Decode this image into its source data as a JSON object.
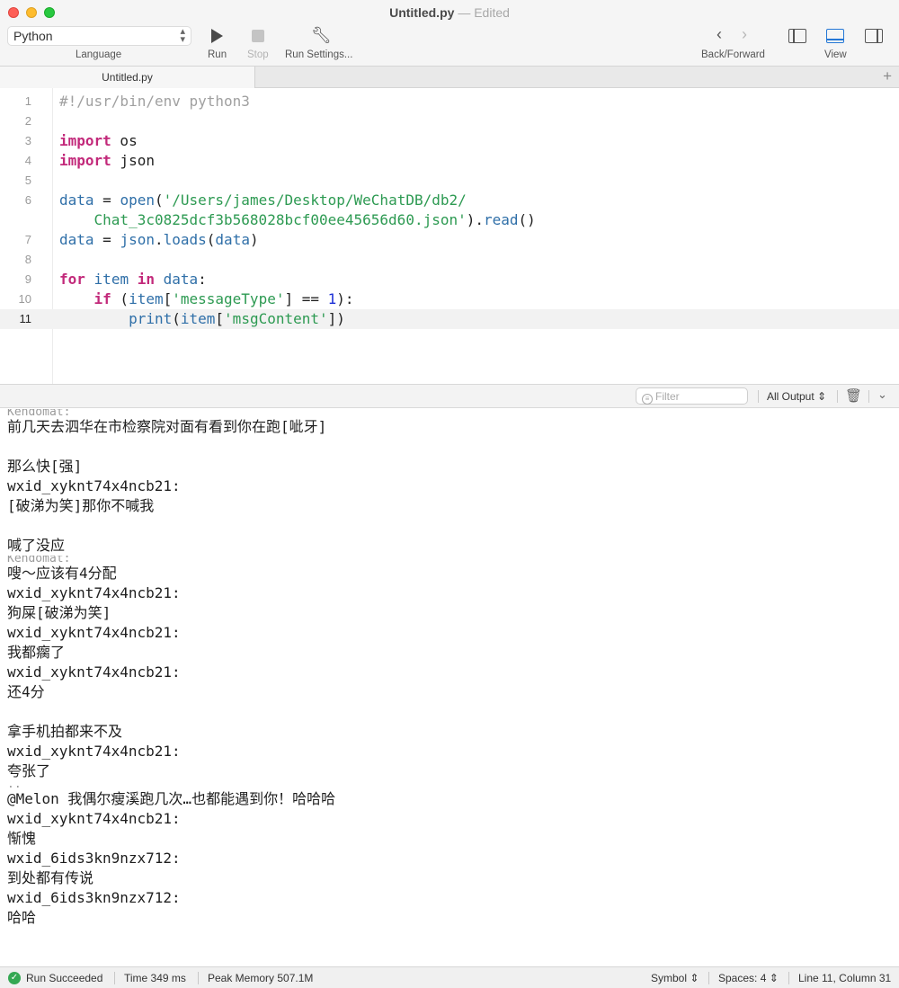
{
  "window": {
    "title": "Untitled.py",
    "separator": "—",
    "status": "Edited"
  },
  "toolbar": {
    "language_value": "Python",
    "language_label": "Language",
    "run_label": "Run",
    "stop_label": "Stop",
    "run_settings_label": "Run Settings...",
    "back_forward_label": "Back/Forward",
    "view_label": "View"
  },
  "tabs": [
    {
      "label": "Untitled.py",
      "active": true
    }
  ],
  "editor": {
    "current_line": 11,
    "lines": [
      {
        "num": "1",
        "tokens": [
          {
            "t": "#!/usr/bin/env python3",
            "c": "cm"
          }
        ]
      },
      {
        "num": "2",
        "tokens": []
      },
      {
        "num": "3",
        "tokens": [
          {
            "t": "import",
            "c": "kw"
          },
          {
            "t": " os",
            "c": "pl"
          }
        ]
      },
      {
        "num": "4",
        "tokens": [
          {
            "t": "import",
            "c": "kw"
          },
          {
            "t": " json",
            "c": "pl"
          }
        ]
      },
      {
        "num": "5",
        "tokens": []
      },
      {
        "num": "6",
        "tokens": [
          {
            "t": "data",
            "c": "fn"
          },
          {
            "t": " = ",
            "c": "pl"
          },
          {
            "t": "open",
            "c": "fn"
          },
          {
            "t": "(",
            "c": "pl"
          },
          {
            "t": "'/Users/james/Desktop/WeChatDB/db2/",
            "c": "str"
          }
        ]
      },
      {
        "num": "",
        "tokens": [
          {
            "t": "    Chat_3c0825dcf3b568028bcf00ee45656d60.json'",
            "c": "str"
          },
          {
            "t": ").",
            "c": "pl"
          },
          {
            "t": "read",
            "c": "fn"
          },
          {
            "t": "()",
            "c": "pl"
          }
        ]
      },
      {
        "num": "7",
        "tokens": [
          {
            "t": "data",
            "c": "fn"
          },
          {
            "t": " = ",
            "c": "pl"
          },
          {
            "t": "json",
            "c": "fn"
          },
          {
            "t": ".",
            "c": "pl"
          },
          {
            "t": "loads",
            "c": "fn"
          },
          {
            "t": "(",
            "c": "pl"
          },
          {
            "t": "data",
            "c": "fn"
          },
          {
            "t": ")",
            "c": "pl"
          }
        ]
      },
      {
        "num": "8",
        "tokens": []
      },
      {
        "num": "9",
        "tokens": [
          {
            "t": "for",
            "c": "kw"
          },
          {
            "t": " ",
            "c": "pl"
          },
          {
            "t": "item",
            "c": "fn"
          },
          {
            "t": " ",
            "c": "pl"
          },
          {
            "t": "in",
            "c": "kw"
          },
          {
            "t": " ",
            "c": "pl"
          },
          {
            "t": "data",
            "c": "fn"
          },
          {
            "t": ":",
            "c": "pl"
          }
        ]
      },
      {
        "num": "10",
        "tokens": [
          {
            "t": "    ",
            "c": "pl"
          },
          {
            "t": "if",
            "c": "kw"
          },
          {
            "t": " (",
            "c": "pl"
          },
          {
            "t": "item",
            "c": "fn"
          },
          {
            "t": "[",
            "c": "pl"
          },
          {
            "t": "'messageType'",
            "c": "str"
          },
          {
            "t": "] == ",
            "c": "pl"
          },
          {
            "t": "1",
            "c": "num"
          },
          {
            "t": "):",
            "c": "pl"
          }
        ]
      },
      {
        "num": "11",
        "tokens": [
          {
            "t": "        ",
            "c": "pl"
          },
          {
            "t": "print",
            "c": "fn"
          },
          {
            "t": "(",
            "c": "pl"
          },
          {
            "t": "item",
            "c": "fn"
          },
          {
            "t": "[",
            "c": "pl"
          },
          {
            "t": "'msgContent'",
            "c": "str"
          },
          {
            "t": "])",
            "c": "pl"
          }
        ]
      }
    ]
  },
  "output_header": {
    "filter_placeholder": "Filter",
    "output_select": "All Output"
  },
  "console_lines": [
    {
      "text": "Kendomat:",
      "partial": true
    },
    {
      "text": "前几天去泗华在市检察院对面有看到你在跑[呲牙]"
    },
    {
      "text": ""
    },
    {
      "text": "那么快[强]"
    },
    {
      "text": "wxid_xyknt74x4ncb21:"
    },
    {
      "text": "[破涕为笑]那你不喊我"
    },
    {
      "text": ""
    },
    {
      "text": "喊了没应"
    },
    {
      "text": "Kendomat:",
      "partial": true
    },
    {
      "text": "嗖～应该有4分配"
    },
    {
      "text": "wxid_xyknt74x4ncb21:"
    },
    {
      "text": "狗屎[破涕为笑]"
    },
    {
      "text": "wxid_xyknt74x4ncb21:"
    },
    {
      "text": "我都瘸了"
    },
    {
      "text": "wxid_xyknt74x4ncb21:"
    },
    {
      "text": "还4分"
    },
    {
      "text": ""
    },
    {
      "text": "拿手机拍都来不及"
    },
    {
      "text": "wxid_xyknt74x4ncb21:"
    },
    {
      "text": "夸张了"
    },
    {
      "text": "..",
      "partial": true
    },
    {
      "text": "@Melon 我偶尔瘦溪跑几次…也都能遇到你！哈哈哈"
    },
    {
      "text": "wxid_xyknt74x4ncb21:"
    },
    {
      "text": "惭愧"
    },
    {
      "text": "wxid_6ids3kn9nzx712:"
    },
    {
      "text": "到处都有传说"
    },
    {
      "text": "wxid_6ids3kn9nzx712:"
    },
    {
      "text": "哈哈"
    }
  ],
  "status_bar": {
    "run_status": "Run Succeeded",
    "time": "Time 349 ms",
    "peak_memory": "Peak Memory 507.1M",
    "syntax": "Symbol",
    "indent": "Spaces: 4",
    "cursor": "Line 11, Column 31"
  },
  "colors": {
    "keyword": "#c2297a",
    "identifier": "#2f6fa8",
    "string": "#2d9a52",
    "number": "#1c2fd6",
    "comment": "#a0a0a0",
    "success": "#34a853",
    "active_view": "#2477d6"
  }
}
